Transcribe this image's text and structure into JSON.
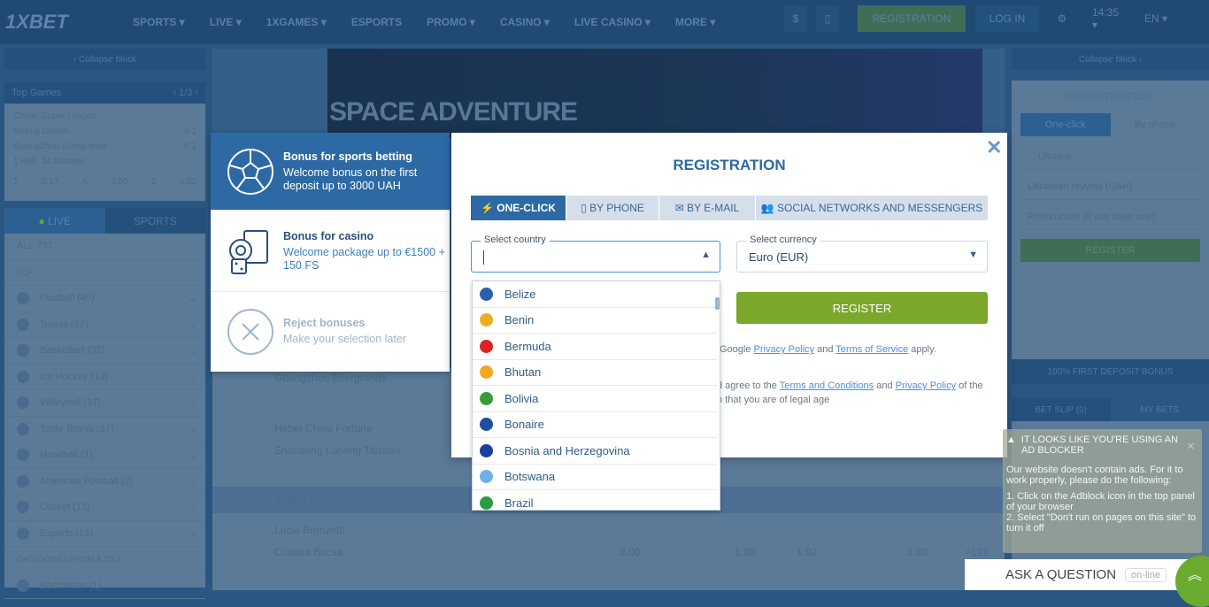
{
  "header": {
    "logo": "1XBET",
    "nav": [
      "SPORTS ▾",
      "LIVE ▾",
      "1XGAMES ▾",
      "ESPORTS",
      "PROMO ▾",
      "CASINO ▾",
      "LIVE CASINO ▾",
      "MORE ▾"
    ],
    "registration": "REGISTRATION",
    "login": "LOG IN",
    "time": "14:35 ▾",
    "lang": "EN ▾"
  },
  "left": {
    "collapse": "‹ Collapse block",
    "top_games": "Top Games",
    "top_games_pager": "‹ 1/3 ›",
    "league": "China. Super League",
    "team1": "Beijing Guoan",
    "team2": "Guangzhou Evergrande",
    "score1": "0 1",
    "score2": "0 1",
    "status": "1 Half, 34 minutes",
    "odds": [
      "1",
      "2.17",
      "X",
      "2.95",
      "2",
      "4.02"
    ],
    "tab_live": "LIVE",
    "tab_sports": "SPORTS",
    "all": "ALL 737",
    "top": "TOP",
    "sports": [
      "Football (45)",
      "Tennis (27)",
      "Basketball (32)",
      "Ice Hockey (13)",
      "Volleyball (17)",
      "Table Tennis (37)",
      "Handball (1)",
      "American Football (2)",
      "Cricket (13)",
      "Esports (13)"
    ],
    "categories": "CATEGORIES FROM A TO Z",
    "badminton": "Badminton (1)"
  },
  "center": {
    "banner_title": "SPACE ADVENTURE",
    "m1": "Guangzhou Evergrande",
    "m2a": "Hebei China Fortune",
    "m2b": "Shandong Luneng Taishan",
    "league2": "WTA. Limoges",
    "p1": "Lucia Bronzetti",
    "p2": "Cristina Bucsa",
    "odds": [
      "2.00",
      "1.80",
      "1.92",
      "1.80",
      "+121"
    ]
  },
  "right": {
    "collapse": "Collapse block ›",
    "title": "REGISTRATION",
    "one_click": "One-click",
    "by_phone": "By phone",
    "country": "Ukraine",
    "currency": "Ukrainian hryvnia (UAH)",
    "promo": "Promo code (if you have one)",
    "register": "REGISTER",
    "bonus": "100% FIRST DEPOSIT BONUS",
    "bet_slip": "BET SLIP (0)",
    "my_bets": "MY BETS"
  },
  "bonus": {
    "sports_title": "Bonus for sports betting",
    "sports_desc": "Welcome bonus on the first deposit up to 3000 UAH",
    "casino_title": "Bonus for casino",
    "casino_desc": "Welcome package up to €1500 + 150 FS",
    "reject_title": "Reject bonuses",
    "reject_desc": "Make your selection later"
  },
  "modal": {
    "title": "REGISTRATION",
    "close": "✕",
    "tabs": [
      "ONE-CLICK",
      "BY PHONE",
      "BY E-MAIL",
      "SOCIAL NETWORKS AND MESSENGERS"
    ],
    "country_label": "Select country",
    "country_value": "",
    "currency_label": "Select currency",
    "currency_value": "Euro (EUR)",
    "register": "REGISTER",
    "recaptcha_pre": "Google",
    "privacy": "Privacy Policy",
    "and": "and",
    "tos": "Terms of Service",
    "apply": "apply.",
    "agree_pre": "d agree to the",
    "terms": "Terms and Conditions",
    "and2": "and",
    "privacy2": "Privacy Policy",
    "of_the": "of the",
    "legal_age": "n that you are of legal age",
    "countries": [
      {
        "name": "Belize",
        "color": "#2a5fb0"
      },
      {
        "name": "Benin",
        "color": "#e8b020"
      },
      {
        "name": "Bermuda",
        "color": "#d22"
      },
      {
        "name": "Bhutan",
        "color": "#f5a623"
      },
      {
        "name": "Bolivia",
        "color": "#3a9a3a"
      },
      {
        "name": "Bonaire",
        "color": "#1c4fa0"
      },
      {
        "name": "Bosnia and Herzegovina",
        "color": "#1b3f9a"
      },
      {
        "name": "Botswana",
        "color": "#6fb0e8"
      },
      {
        "name": "Brazil",
        "color": "#2e9b3d"
      }
    ]
  },
  "adblock": {
    "title": "IT LOOKS LIKE YOU'RE USING AN AD BLOCKER",
    "body": "Our website doesn't contain ads. For it to work properly, please do the following:",
    "step1": "1. Click on the Adblock icon in the top panel of your browser",
    "step2": "2. Select \"Don't run on pages on this site\" to turn it off"
  },
  "ask": {
    "label": "ASK A QUESTION",
    "status": "on-line"
  }
}
